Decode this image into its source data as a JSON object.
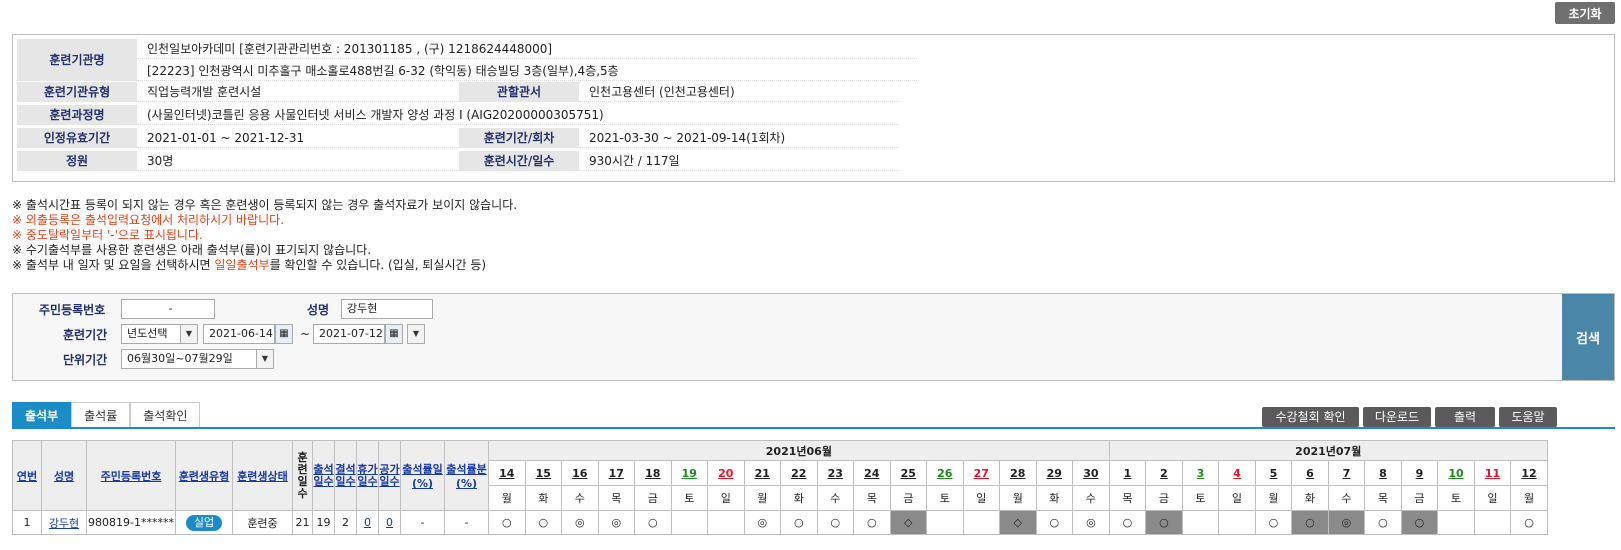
{
  "reset_label": "초기화",
  "institution": {
    "name_label": "훈련기관명",
    "name_value": "인천일보아카데미  [훈련기관관리번호 : 201301185 , (구) 1218624448000]",
    "address_value": "[22223] 인천광역시 미추홀구 매소홀로488번길 6-32 (학익동) 태승빌딩 3층(일부),4층,5층",
    "type_label": "훈련기관유형",
    "type_value": "직업능력개발 훈련시설",
    "office_label": "관할관서",
    "office_value": "인천고용센터 (인천고용센터)",
    "course_label": "훈련과정명",
    "course_value": "(사물인터넷)코틀린 응용 사물인터넷 서비스 개발자 양성 과정  I  (AIG20200000305751)",
    "valid_label": "인정유효기간",
    "valid_value": "2021-01-01 ~ 2021-12-31",
    "period_label": "훈련기간/회차",
    "period_value": "2021-03-30 ~ 2021-09-14(1회차)",
    "capacity_label": "정원",
    "capacity_value": "30명",
    "hours_label": "훈련시간/일수",
    "hours_value": "930시간 / 117일"
  },
  "notes": {
    "n1": "※ 출석시간표 등록이 되지 않는 경우 혹은 훈련생이 등록되지 않는 경우 출석자료가 보이지 않습니다.",
    "n2": "※ 외출등록은 출석입력요청에서 처리하시기 바랍니다.",
    "n3": "※ 중도탈락일부터 '-'으로 표시됩니다.",
    "n4": "※ 수기출석부를 사용한 훈련생은 아래 출석부(률)이 표기되지 않습니다.",
    "n5_pre": "※ 출석부 내 일자 및 요일을 선택하시면 ",
    "n5_hl": "일일출석부",
    "n5_post": "를 확인할 수 있습니다. (입실, 퇴실시간 등)"
  },
  "search": {
    "rrn_label": "주민등록번호",
    "rrn_value": "-",
    "name_label": "성명",
    "name_value": "강두현",
    "period_label": "훈련기간",
    "year_select": "년도선택",
    "start_date": "2021-06-14",
    "tilde": "~",
    "end_date": "2021-07-12",
    "unit_label": "단위기간",
    "unit_value": "06월30일~07월29일",
    "search_button": "검색"
  },
  "tabs": [
    "출석부",
    "출석률",
    "출석확인"
  ],
  "actions": {
    "withdraw": "수강철회 확인",
    "download": "다운로드",
    "print": "출력",
    "help": "도움말"
  },
  "table": {
    "headers": {
      "no": "연번",
      "name": "성명",
      "rrn": "주민등록번호",
      "type": "훈련생유형",
      "status": "훈련생상태",
      "days": "훈련일수",
      "attend": "출석일수",
      "absent": "결석일수",
      "leave": "휴가일수",
      "official": "공가일수",
      "rate1": "출석률일(%)",
      "rate2": "출석률분(%)"
    },
    "month1": "2021년06월",
    "month2": "2021년07월",
    "days": [
      {
        "d": "14",
        "w": "월",
        "c": ""
      },
      {
        "d": "15",
        "w": "화",
        "c": ""
      },
      {
        "d": "16",
        "w": "수",
        "c": ""
      },
      {
        "d": "17",
        "w": "목",
        "c": ""
      },
      {
        "d": "18",
        "w": "금",
        "c": ""
      },
      {
        "d": "19",
        "w": "토",
        "c": "sat"
      },
      {
        "d": "20",
        "w": "일",
        "c": "sun"
      },
      {
        "d": "21",
        "w": "월",
        "c": ""
      },
      {
        "d": "22",
        "w": "화",
        "c": ""
      },
      {
        "d": "23",
        "w": "수",
        "c": ""
      },
      {
        "d": "24",
        "w": "목",
        "c": ""
      },
      {
        "d": "25",
        "w": "금",
        "c": ""
      },
      {
        "d": "26",
        "w": "토",
        "c": "sat"
      },
      {
        "d": "27",
        "w": "일",
        "c": "sun"
      },
      {
        "d": "28",
        "w": "월",
        "c": ""
      },
      {
        "d": "29",
        "w": "화",
        "c": ""
      },
      {
        "d": "30",
        "w": "수",
        "c": ""
      },
      {
        "d": "1",
        "w": "목",
        "c": ""
      },
      {
        "d": "2",
        "w": "금",
        "c": ""
      },
      {
        "d": "3",
        "w": "토",
        "c": "sat"
      },
      {
        "d": "4",
        "w": "일",
        "c": "sun"
      },
      {
        "d": "5",
        "w": "월",
        "c": ""
      },
      {
        "d": "6",
        "w": "화",
        "c": ""
      },
      {
        "d": "7",
        "w": "수",
        "c": ""
      },
      {
        "d": "8",
        "w": "목",
        "c": ""
      },
      {
        "d": "9",
        "w": "금",
        "c": ""
      },
      {
        "d": "10",
        "w": "토",
        "c": "sat"
      },
      {
        "d": "11",
        "w": "일",
        "c": "sun"
      },
      {
        "d": "12",
        "w": "월",
        "c": ""
      }
    ],
    "row": {
      "no": "1",
      "name": "강두현",
      "rrn": "980819-1******",
      "type": "실업",
      "status": "훈련중",
      "days": "21",
      "attend": "19",
      "absent": "2",
      "leave": "0",
      "official": "0",
      "rate1": "-",
      "rate2": "-",
      "marks": [
        {
          "s": "○",
          "g": false
        },
        {
          "s": "○",
          "g": false
        },
        {
          "s": "◎",
          "g": false
        },
        {
          "s": "◎",
          "g": false
        },
        {
          "s": "○",
          "g": false
        },
        {
          "s": "",
          "g": false
        },
        {
          "s": "",
          "g": false
        },
        {
          "s": "◎",
          "g": false
        },
        {
          "s": "○",
          "g": false
        },
        {
          "s": "○",
          "g": false
        },
        {
          "s": "○",
          "g": false
        },
        {
          "s": "◇",
          "g": true
        },
        {
          "s": "",
          "g": false
        },
        {
          "s": "",
          "g": false
        },
        {
          "s": "◇",
          "g": true
        },
        {
          "s": "○",
          "g": false
        },
        {
          "s": "◎",
          "g": false
        },
        {
          "s": "○",
          "g": false
        },
        {
          "s": "○",
          "g": true
        },
        {
          "s": "",
          "g": false
        },
        {
          "s": "",
          "g": false
        },
        {
          "s": "○",
          "g": false
        },
        {
          "s": "○",
          "g": true
        },
        {
          "s": "◎",
          "g": true
        },
        {
          "s": "○",
          "g": false
        },
        {
          "s": "○",
          "g": true
        },
        {
          "s": "",
          "g": false
        },
        {
          "s": "",
          "g": false
        },
        {
          "s": "○",
          "g": false
        }
      ]
    }
  }
}
